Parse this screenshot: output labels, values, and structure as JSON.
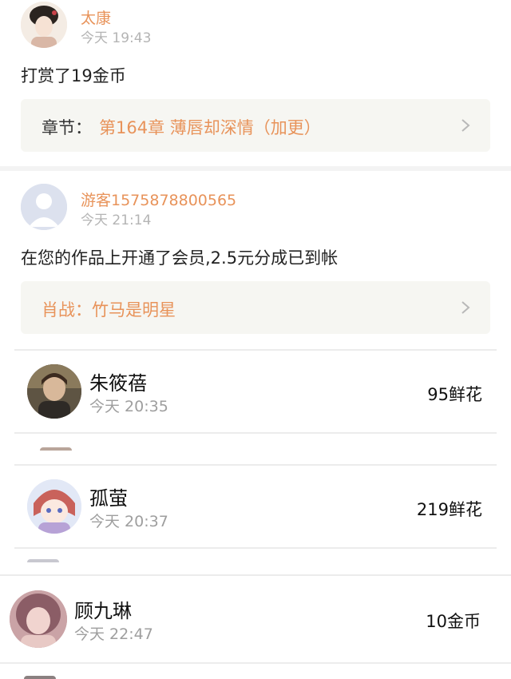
{
  "messages": [
    {
      "user": "太康",
      "time": "今天 19:43",
      "text": "打赏了19金币",
      "chapter_label": "章节：",
      "chapter_title": "第164章 薄唇却深情（加更）"
    },
    {
      "user": "游客1575878800565",
      "time": "今天 21:14",
      "text": "在您的作品上开通了会员,2.5元分成已到帐",
      "chapter_label": "",
      "chapter_title": "肖战：竹马是明星"
    }
  ],
  "gifts": [
    {
      "user": "朱筱蓓",
      "time": "今天 20:35",
      "value": "95鲜花"
    },
    {
      "user": "孤萤",
      "time": "今天 20:37",
      "value": "219鲜花"
    },
    {
      "user": "顾九琳",
      "time": "今天 22:47",
      "value": "10金币"
    }
  ],
  "colors": {
    "accent": "#e8935a",
    "box_bg": "#f6f6f2",
    "divider": "#ececec"
  },
  "icons": {
    "chevron": "chevron-right-icon",
    "default_avatar": "default-avatar-icon"
  }
}
